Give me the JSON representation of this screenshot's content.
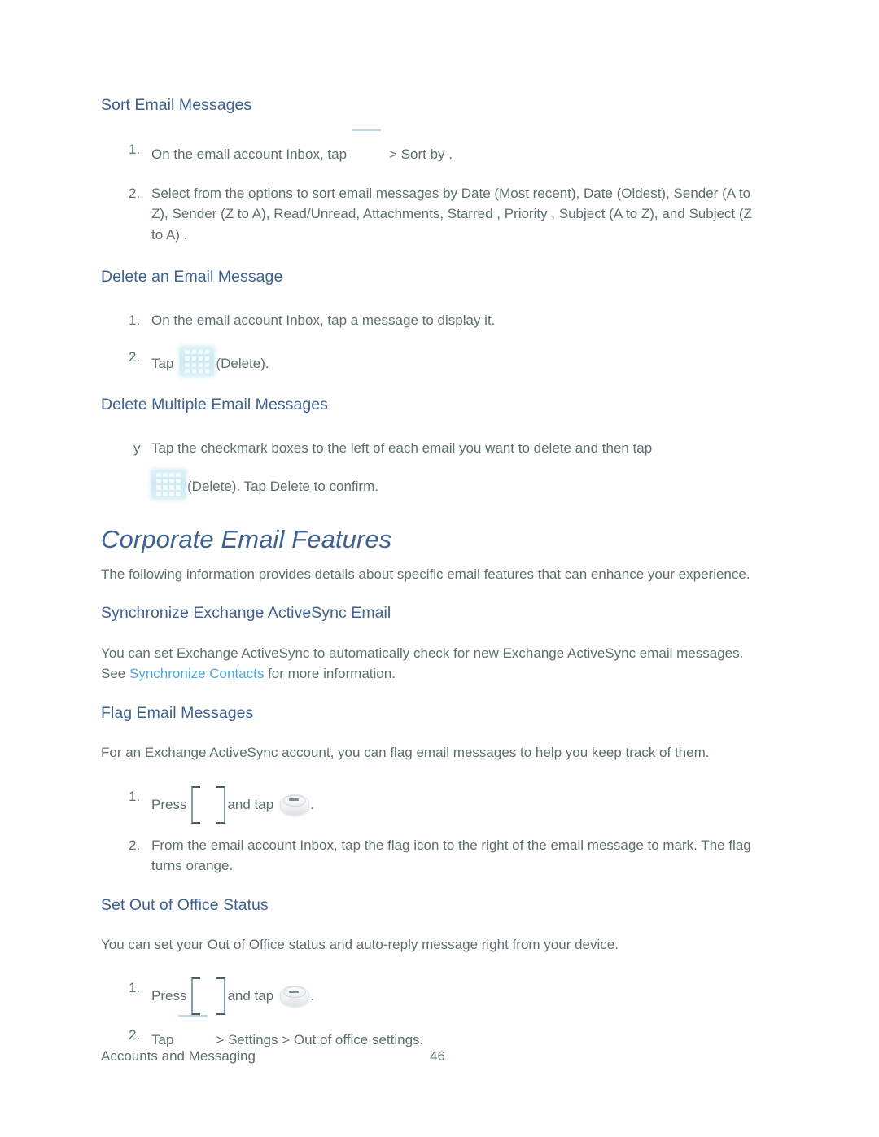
{
  "document": {
    "page_number": "46",
    "footer_label": "Accounts and Messaging"
  },
  "colors": {
    "heading_blue": "#3f6190",
    "link_blue": "#4fa8dc",
    "body_gray": "#5e6e6e",
    "icon_bg_cyan": "#cfeaf3"
  },
  "sections": {
    "sort_email": {
      "heading": "Sort Email Messages",
      "steps": [
        {
          "marker": "1.",
          "text_before": "On the email account Inbox, tap",
          "icon": "menu-icon-placeholder",
          "text_after": "> Sort  by ."
        },
        {
          "marker": "2.",
          "text": "Select from the options to sort email messages by Date (Most recent),  Date (Oldest), Sender (A to Z),  Sender (Z to A),  Read/Unread,  Attachments,  Starred , Priority ,  Subject  (A to Z),  and Subject (Z to A) ."
        }
      ]
    },
    "delete_email": {
      "heading": "Delete an Email Message",
      "steps": [
        {
          "marker": "1.",
          "text": "On the email account Inbox, tap a message to display it."
        },
        {
          "marker": "2.",
          "text_before": "Tap",
          "icon": "delete-icon",
          "text_after": "(Delete)."
        }
      ]
    },
    "delete_multiple": {
      "heading": "Delete Multiple Email Messages",
      "steps": [
        {
          "marker": "y",
          "text_before": "Tap the checkmark boxes to the left of each email you want to delete and then tap",
          "icon": "delete-icon",
          "text_after": "(Delete). Tap Delete  to confirm."
        }
      ]
    },
    "corporate_email": {
      "title": "Corporate Email Features",
      "intro": "The following information provides details about specific email features that can enhance your experience."
    },
    "synchronize": {
      "heading": "Synchronize Exchange ActiveSync Email",
      "paragraph_before": "You can set Exchange ActiveSync to automatically check for new Exchange ActiveSync email messages. See ",
      "link_text": "Synchronize Contacts",
      "paragraph_after": " for more information."
    },
    "flag_email": {
      "heading": "Flag Email Messages",
      "paragraph": "For an Exchange ActiveSync account, you can flag email messages to help you keep track of them.",
      "steps": [
        {
          "marker": "1.",
          "text_before": "Press",
          "icon_a": "missing-image-placeholder",
          "text_middle": "and tap",
          "icon_b": "menu-key-icon",
          "text_after": "."
        },
        {
          "marker": "2.",
          "text": "From the email account Inbox, tap the flag icon to the right of the email message to mark. The flag turns orange."
        }
      ]
    },
    "out_of_office": {
      "heading": "Set Out of Office Status",
      "paragraph": "You can set your Out of Office status and auto-reply message right from your device.",
      "steps": [
        {
          "marker": "1.",
          "text_before": "Press",
          "icon_a": "missing-image-placeholder",
          "text_middle": "and tap",
          "icon_b": "menu-key-icon",
          "text_after": "."
        },
        {
          "marker": "2.",
          "text_before": "Tap",
          "icon": "menu-icon-placeholder",
          "text_after": "> Settings  > Out of office settings."
        }
      ]
    }
  }
}
